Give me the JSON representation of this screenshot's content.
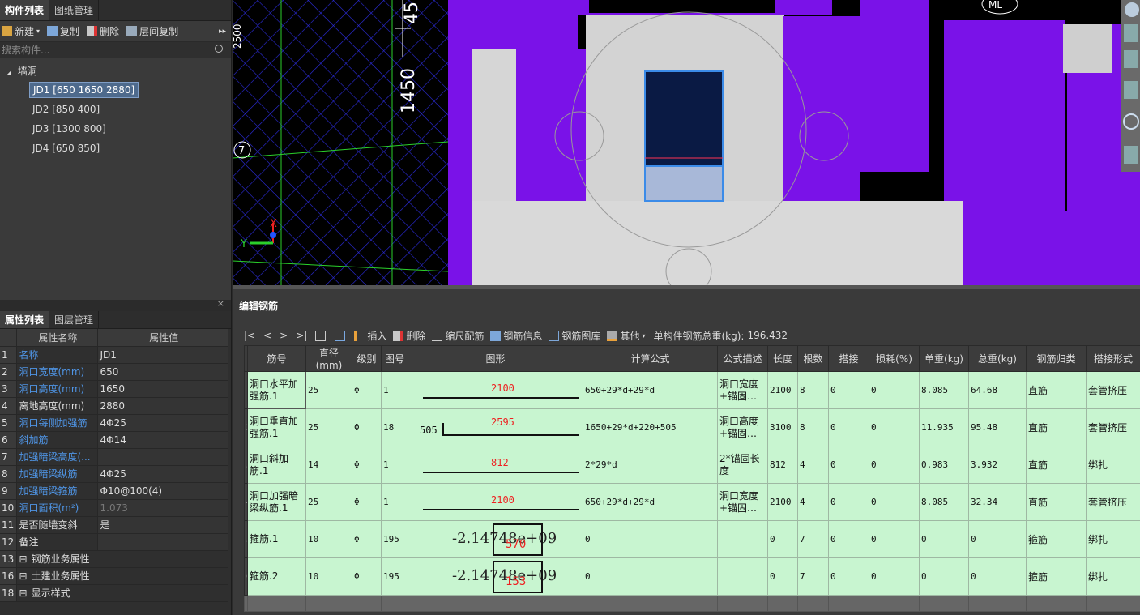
{
  "left_tabs": [
    "构件列表",
    "图纸管理"
  ],
  "left_toolbar": {
    "new": "新建",
    "copy": "复制",
    "delete": "删除",
    "floor_copy": "层间复制",
    "more": "▸▸"
  },
  "search": {
    "placeholder": "搜索构件..."
  },
  "tree": {
    "root": "墙洞",
    "items": [
      "JD1 [650 1650 2880]",
      "JD2 [850 400]",
      "JD3 [1300 800]",
      "JD4 [650 850]"
    ]
  },
  "prop_tabs": [
    "属性列表",
    "图层管理"
  ],
  "prop_header": {
    "name": "属性名称",
    "value": "属性值"
  },
  "props": [
    {
      "n": "1",
      "k": "名称",
      "v": "JD1",
      "blue": true
    },
    {
      "n": "2",
      "k": "洞口宽度(mm)",
      "v": "650",
      "blue": true
    },
    {
      "n": "3",
      "k": "洞口高度(mm)",
      "v": "1650",
      "blue": true
    },
    {
      "n": "4",
      "k": "离地高度(mm)",
      "v": "2880",
      "blue": false
    },
    {
      "n": "5",
      "k": "洞口每侧加强筋",
      "v": "4Φ25",
      "blue": true
    },
    {
      "n": "6",
      "k": "斜加筋",
      "v": "4Φ14",
      "blue": true
    },
    {
      "n": "7",
      "k": "加强暗梁高度(...",
      "v": "",
      "blue": true
    },
    {
      "n": "8",
      "k": "加强暗梁纵筋",
      "v": "4Φ25",
      "blue": true
    },
    {
      "n": "9",
      "k": "加强暗梁箍筋",
      "v": "Φ10@100(4)",
      "blue": true
    },
    {
      "n": "10",
      "k": "洞口面积(m²)",
      "v": "1.073",
      "blue": true
    },
    {
      "n": "11",
      "k": "是否随墙变斜",
      "v": "是",
      "blue": false
    },
    {
      "n": "12",
      "k": "备注",
      "v": "",
      "blue": false
    },
    {
      "n": "13",
      "k": "钢筋业务属性",
      "v": "",
      "blue": false,
      "expand": true
    },
    {
      "n": "16",
      "k": "土建业务属性",
      "v": "",
      "blue": false,
      "expand": true
    },
    {
      "n": "18",
      "k": "显示样式",
      "v": "",
      "blue": false,
      "expand": true
    }
  ],
  "viewport": {
    "dim1": "1450",
    "dim2": "45",
    "dim3": "2500",
    "axis": "7",
    "ml": "ML",
    "x": "X",
    "y": "Y"
  },
  "editor": {
    "title": "编辑钢筋",
    "nav": [
      "|<",
      "<",
      ">",
      ">|"
    ],
    "tools": {
      "insert": "插入",
      "delete": "删除",
      "scale": "缩尺配筋",
      "info": "钢筋信息",
      "lib": "钢筋图库",
      "other": "其他",
      "total_label": "单构件钢筋总重(kg):",
      "total": "196.432"
    },
    "headers": [
      "筋号",
      "直径(mm)",
      "级别",
      "图号",
      "图形",
      "计算公式",
      "公式描述",
      "长度",
      "根数",
      "搭接",
      "损耗(%)",
      "单重(kg)",
      "总重(kg)",
      "钢筋归类",
      "搭接形式"
    ],
    "rows": [
      {
        "rn": "1",
        "name": "洞口水平加强筋.1",
        "dia": "25",
        "grade": "Φ",
        "fig": "1",
        "shape_val": "2100",
        "shape_left": "",
        "formula": "650+29*d+29*d",
        "desc": "洞口宽度+锚固…",
        "len": "2100",
        "cnt": "8",
        "lap": "0",
        "loss": "0",
        "unit": "8.085",
        "total": "64.68",
        "cat": "直筋",
        "lapf": "套管挤压"
      },
      {
        "rn": "2",
        "name": "洞口垂直加强筋.1",
        "dia": "25",
        "grade": "Φ",
        "fig": "18",
        "shape_val": "2595",
        "shape_left": "505",
        "formula": "1650+29*d+220+505",
        "desc": "洞口高度+锚固…",
        "len": "3100",
        "cnt": "8",
        "lap": "0",
        "loss": "0",
        "unit": "11.935",
        "total": "95.48",
        "cat": "直筋",
        "lapf": "套管挤压"
      },
      {
        "rn": "3",
        "name": "洞口斜加筋.1",
        "dia": "14",
        "grade": "Φ",
        "fig": "1",
        "shape_val": "812",
        "shape_left": "",
        "formula": "2*29*d",
        "desc": "2*锚固长度",
        "len": "812",
        "cnt": "4",
        "lap": "0",
        "loss": "0",
        "unit": "0.983",
        "total": "3.932",
        "cat": "直筋",
        "lapf": "绑扎"
      },
      {
        "rn": "4",
        "name": "洞口加强暗梁纵筋.1",
        "dia": "25",
        "grade": "Φ",
        "fig": "1",
        "shape_val": "2100",
        "shape_left": "",
        "formula": "650+29*d+29*d",
        "desc": "洞口宽度+锚固…",
        "len": "2100",
        "cnt": "4",
        "lap": "0",
        "loss": "0",
        "unit": "8.085",
        "total": "32.34",
        "cat": "直筋",
        "lapf": "套管挤压"
      },
      {
        "rn": "5",
        "name": "箍筋.1",
        "dia": "10",
        "grade": "Φ",
        "fig": "195",
        "shape_val": "570",
        "shape_left": "-2.14748e+09",
        "formula": "0",
        "desc": "",
        "len": "0",
        "cnt": "7",
        "lap": "0",
        "loss": "0",
        "unit": "0",
        "total": "0",
        "cat": "箍筋",
        "lapf": "绑扎"
      },
      {
        "rn": "6",
        "name": "箍筋.2",
        "dia": "10",
        "grade": "Φ",
        "fig": "195",
        "shape_val": "153",
        "shape_left": "-2.14748e+09",
        "formula": "0",
        "desc": "",
        "len": "0",
        "cnt": "7",
        "lap": "0",
        "loss": "0",
        "unit": "0",
        "total": "0",
        "cat": "箍筋",
        "lapf": "绑扎"
      }
    ],
    "empty_rn": "7"
  }
}
